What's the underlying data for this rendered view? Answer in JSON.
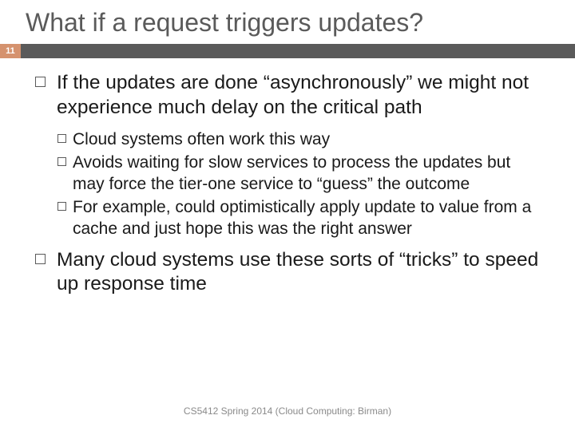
{
  "slide": {
    "title": "What if a request triggers updates?",
    "number": "11",
    "footer": "CS5412 Spring 2014 (Cloud Computing: Birman)",
    "bullets": [
      {
        "text": "If the updates are done “asynchronously” we might not experience much delay on the critical path",
        "sub": [
          "Cloud systems often work this way",
          "Avoids waiting for slow services to process the updates but may force the tier-one service to “guess” the outcome",
          "For example, could optimistically apply update to value from a cache and just hope this was the right answer"
        ]
      },
      {
        "text": "Many cloud systems use these sorts of “tricks” to speed up response time",
        "sub": []
      }
    ]
  }
}
